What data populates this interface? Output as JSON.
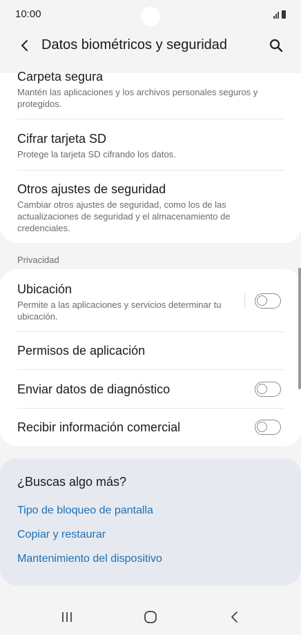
{
  "status": {
    "time": "10:00"
  },
  "header": {
    "title": "Datos biométricos y seguridad"
  },
  "security_items": [
    {
      "title": "Carpeta segura",
      "subtitle": "Mantén las aplicaciones y los archivos personales seguros y protegidos."
    },
    {
      "title": "Cifrar tarjeta SD",
      "subtitle": "Protege la tarjeta SD cifrando los datos."
    },
    {
      "title": "Otros ajustes de seguridad",
      "subtitle": "Cambiar otros ajustes de seguridad, como los de las actualizaciones de seguridad y el almacenamiento de credenciales."
    }
  ],
  "privacy": {
    "header": "Privacidad",
    "location": {
      "title": "Ubicación",
      "subtitle": "Permite a las aplicaciones y servicios determinar tu ubicación.",
      "enabled": false
    },
    "app_permissions": {
      "title": "Permisos de aplicación"
    },
    "diagnostics": {
      "title": "Enviar datos de diagnóstico",
      "enabled": false
    },
    "marketing": {
      "title": "Recibir información comercial",
      "enabled": false
    }
  },
  "suggestions": {
    "title": "¿Buscas algo más?",
    "links": [
      "Tipo de bloqueo de pantalla",
      "Copiar y restaurar",
      "Mantenimiento del dispositivo"
    ]
  },
  "colors": {
    "link": "#1e6fb5",
    "background": "#f4f4f5",
    "card": "#ffffff",
    "suggestion_card": "#e6eaf0"
  },
  "icons": {
    "back": "chevron-left-icon",
    "search": "search-icon",
    "recents": "recents-icon",
    "home": "home-icon",
    "nav_back": "nav-back-icon"
  }
}
